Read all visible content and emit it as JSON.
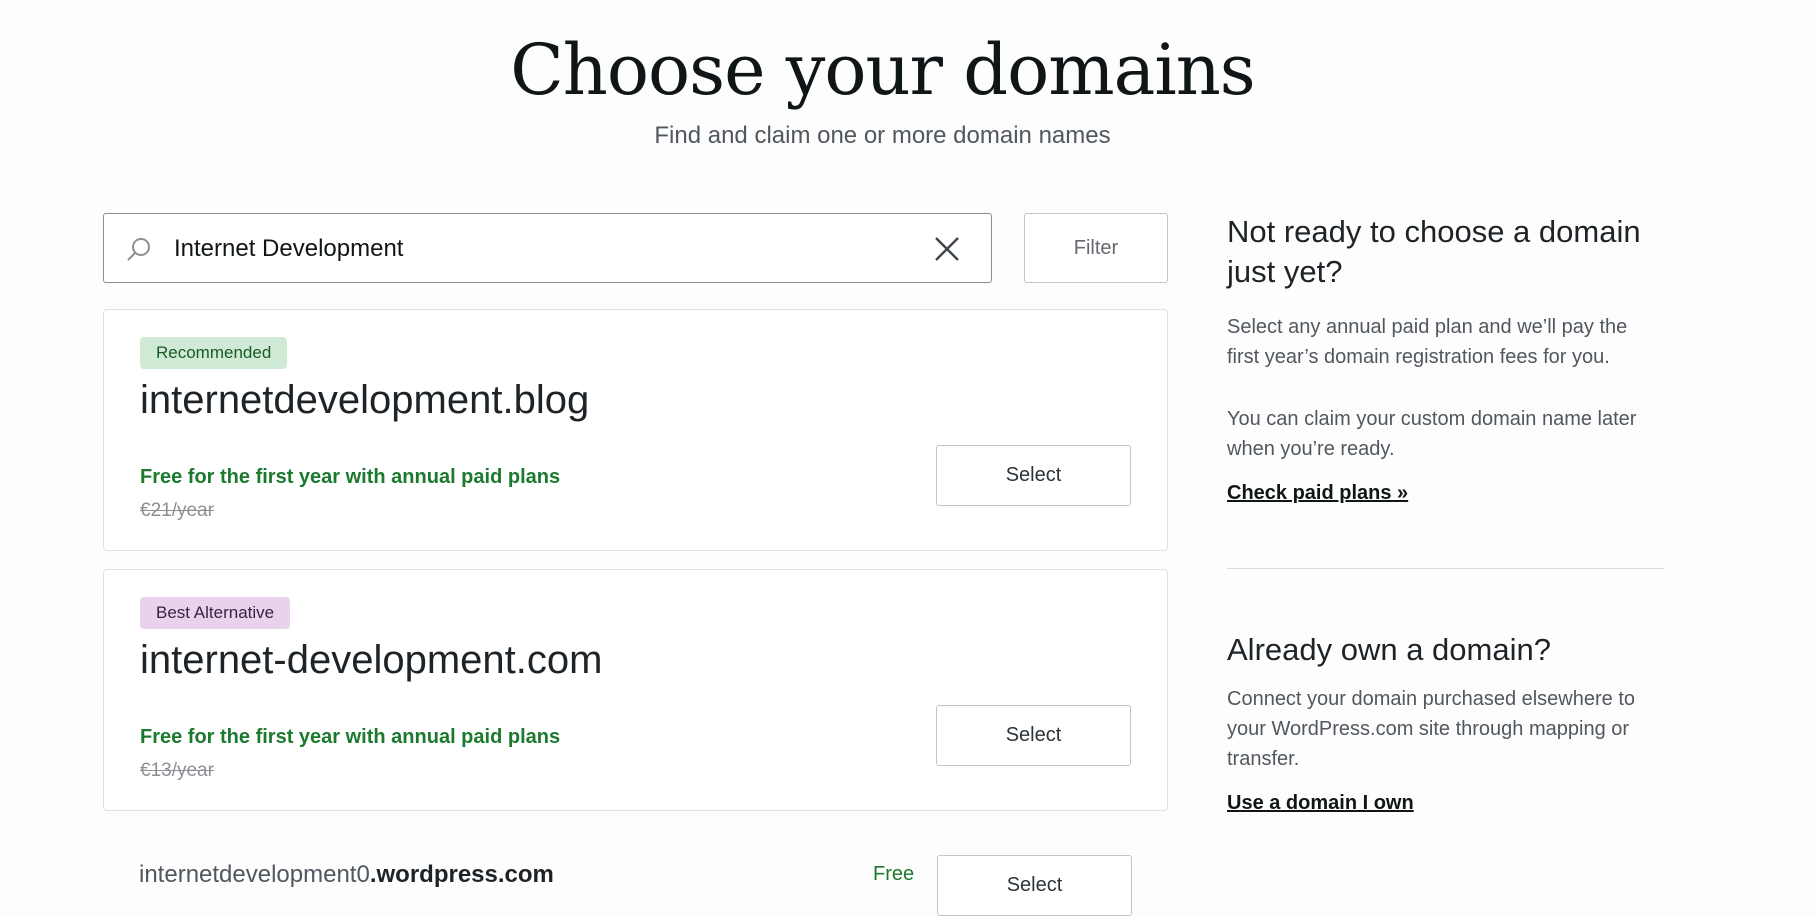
{
  "header": {
    "title": "Choose your domains",
    "subtitle": "Find and claim one or more domain names"
  },
  "search": {
    "value": "Internet Development",
    "icon": "search-icon",
    "clear_icon": "close-icon"
  },
  "filter": {
    "label": "Filter"
  },
  "results": [
    {
      "badge": "Recommended",
      "domain": "internetdevelopment.blog",
      "promo": "Free for the first year with annual paid plans",
      "old_price": "€21/year",
      "select_label": "Select"
    },
    {
      "badge": "Best Alternative",
      "domain": "internet-development.com",
      "promo": "Free for the first year with annual paid plans",
      "old_price": "€13/year",
      "select_label": "Select"
    }
  ],
  "free_result": {
    "subdomain": "internetdevelopment0",
    "suffix": ".wordpress.com",
    "price": "Free",
    "select_label": "Select"
  },
  "sidebar": {
    "not_ready": {
      "heading": "Not ready to choose a domain just yet?",
      "text1": "Select any annual paid plan and we’ll pay the first year’s domain registration fees for you.",
      "text2": "You can claim your custom domain name later when you’re ready.",
      "link": "Check paid plans »"
    },
    "own_domain": {
      "heading": "Already own a domain?",
      "text": "Connect your domain purchased elsewhere to your WordPress.com site through mapping or transfer.",
      "link": "Use a domain I own"
    }
  },
  "colors": {
    "recommended_badge_bg": "#d0ead5",
    "alternative_badge_bg": "#e8d2ec",
    "promo_green": "#1b7a2e"
  }
}
